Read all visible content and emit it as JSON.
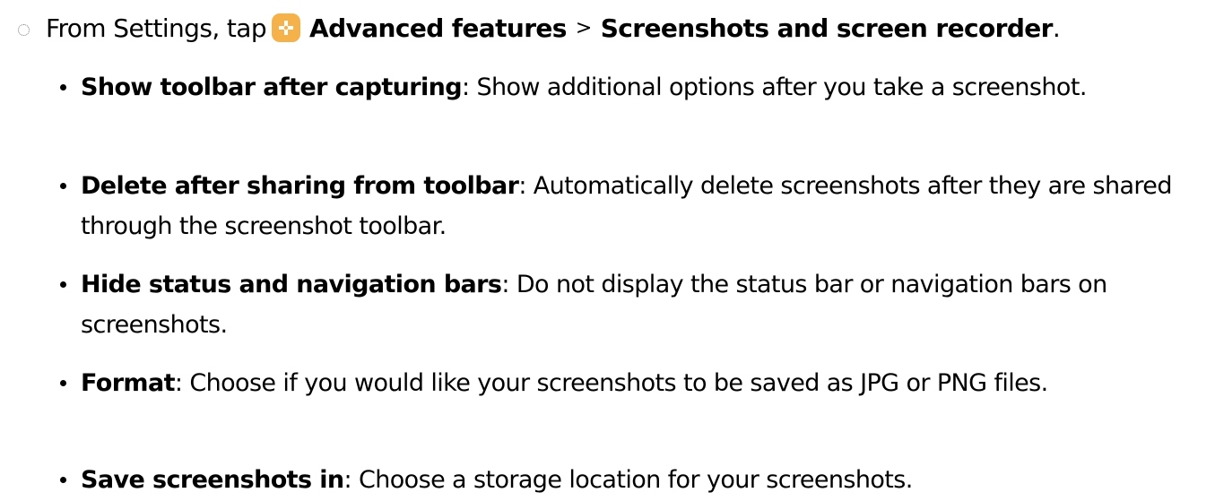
{
  "step": {
    "lead_text": "From Settings, tap",
    "app_icon": "advanced-features-icon",
    "icon_color": "#f6b24a",
    "menu_item": "Advanced features",
    "separator": ">",
    "submenu_item": "Screenshots and screen recorder",
    "end_punct": "."
  },
  "options": [
    {
      "title": "Show toolbar after capturing",
      "desc": ": Show additional options after you take a screenshot."
    },
    {
      "title": "Delete after sharing from toolbar",
      "desc": ": Automatically delete screenshots after they are shared through the screenshot toolbar."
    },
    {
      "title": "Hide status and navigation bars",
      "desc": ": Do not display the status bar or navigation bars on screenshots."
    },
    {
      "title": "Format",
      "desc": ": Choose if you would like your screenshots to be saved as JPG or PNG files."
    },
    {
      "title": "Save screenshots in",
      "desc": ": Choose a storage location for your screenshots."
    }
  ]
}
